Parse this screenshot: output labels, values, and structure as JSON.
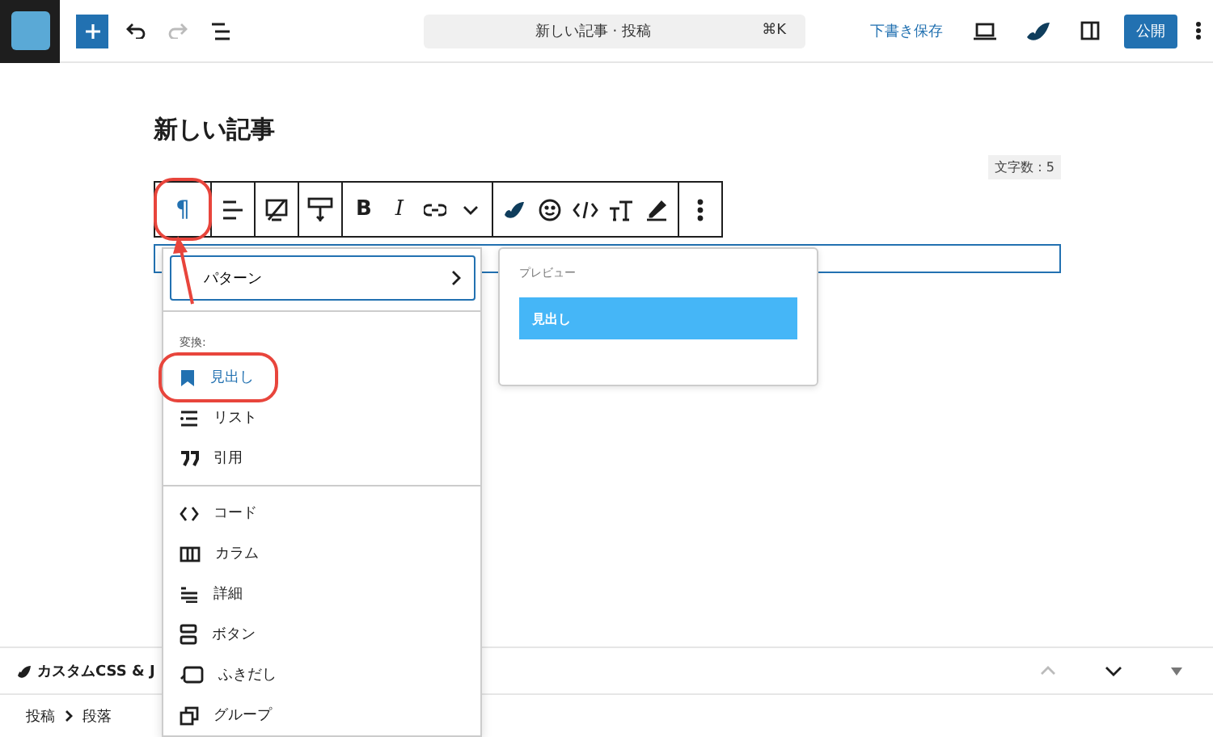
{
  "top_bar": {
    "undo": {
      "disabled": false
    },
    "redo": {
      "disabled": true
    },
    "command_center": {
      "title": "新しい記事 · 投稿",
      "shortcut": "⌘K"
    },
    "save_draft": "下書き保存",
    "publish": "公開"
  },
  "post_title": "新しい記事",
  "word_count": "文字数 : 5",
  "block_toolbar": [
    [
      {
        "kind": "glyph",
        "label": "¶"
      }
    ],
    [
      {
        "kind": "icon"
      }
    ],
    [
      {
        "kind": "icon"
      }
    ],
    [
      {
        "kind": "icon"
      }
    ],
    [
      {
        "kind": "glyph",
        "label": "B"
      },
      {
        "kind": "glyph",
        "label": "I"
      },
      {
        "kind": "icon"
      },
      {
        "kind": "icon"
      }
    ],
    [
      {
        "kind": "icon"
      },
      {
        "kind": "icon"
      },
      {
        "kind": "icon"
      },
      {
        "kind": "icon"
      },
      {
        "kind": "icon"
      }
    ],
    [
      {
        "kind": "icon"
      }
    ]
  ],
  "transform_menu": {
    "pattern_button": "パターン",
    "section_label": "変換:",
    "groups": [
      [
        {
          "label": "見出し",
          "selected": true
        },
        {
          "label": "リスト",
          "selected": false
        },
        {
          "label": "引用",
          "selected": false
        }
      ],
      [
        {
          "label": "コード",
          "selected": false
        },
        {
          "label": "カラム",
          "selected": false
        },
        {
          "label": "詳細",
          "selected": false
        },
        {
          "label": "ボタン",
          "selected": false
        },
        {
          "label": "ふきだし",
          "selected": false
        },
        {
          "label": "グループ",
          "selected": false
        }
      ]
    ]
  },
  "preview": {
    "label": "プレビュー",
    "heading": "見出し"
  },
  "annotations": {
    "circles": true,
    "arrow": true
  },
  "meta_box": {
    "title": "カスタムCSS & J"
  },
  "breadcrumb": [
    "投稿",
    "段落"
  ]
}
